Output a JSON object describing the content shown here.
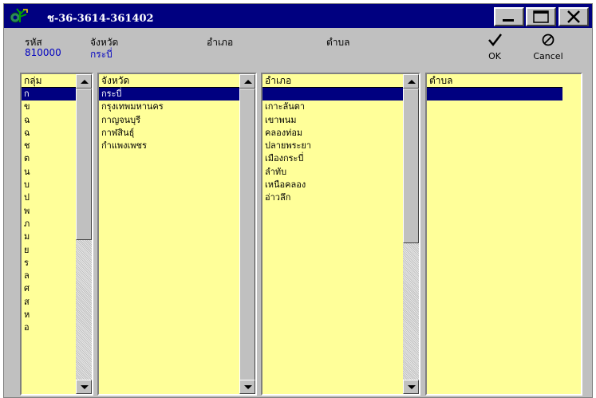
{
  "window": {
    "title": "ช-36-3614-361402"
  },
  "header": {
    "code_label": "รหัส",
    "code_value": "810000",
    "province_label": "จังหวัด",
    "province_value": "กระบี่",
    "district_label": "อำเภอ",
    "subdistrict_label": "ตำบล"
  },
  "toolbar": {
    "ok_label": "OK",
    "cancel_label": "Cancel"
  },
  "lists": {
    "group": {
      "header": "กลุ่ม",
      "items": [
        "ก",
        "ข",
        "ฉ",
        "ฉ",
        "ช",
        "ต",
        "น",
        "บ",
        "ป",
        "พ",
        "ภ",
        "ม",
        "ย",
        "ร",
        "ล",
        "ศ",
        "ส",
        "ห",
        "อ"
      ],
      "selected_index": 0
    },
    "province": {
      "header": "จังหวัด",
      "items": [
        "กระบี่",
        "กรุงเทพมหานคร",
        "กาญจนบุรี",
        "กาฬสินธุ์",
        "กำแพงเพชร"
      ],
      "selected_index": 0
    },
    "district": {
      "header": "อำเภอ",
      "items": [
        "",
        "เกาะลันตา",
        "เขาพนม",
        "คลองท่อม",
        "ปลายพระยา",
        "เมืองกระบี่",
        "ลำทับ",
        "เหนือคลอง",
        "อ่าวลึก"
      ],
      "selected_index": 0
    },
    "subdistrict": {
      "header": "ตำบล",
      "items": [
        ""
      ],
      "selected_index": 0
    }
  },
  "colors": {
    "titlebar": "#000080",
    "list_background": "#ffff99",
    "selection": "#000080",
    "header_value": "#0000c0"
  },
  "icons": {
    "app": "gear-plant-icon",
    "minimize": "minimize-icon",
    "maximize": "maximize-icon",
    "close": "close-icon",
    "ok": "checkmark-icon",
    "cancel": "cancel-circle-icon"
  }
}
